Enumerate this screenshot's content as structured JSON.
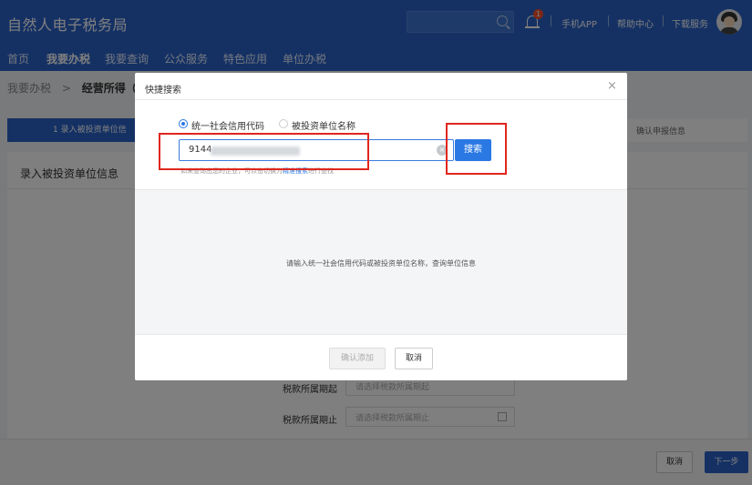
{
  "header": {
    "brand": "自然人电子税务局",
    "notification_count": "1",
    "links": [
      "手机APP",
      "帮助中心",
      "下载服务"
    ]
  },
  "nav": {
    "items": [
      "首页",
      "我要办税",
      "我要查询",
      "公众服务",
      "特色应用",
      "单位办税"
    ],
    "active": "我要办税"
  },
  "breadcrumb": {
    "parent": "我要办税",
    "separator": ">",
    "current": "经营所得（A表"
  },
  "steps": {
    "first": "1  录入被投资单位信",
    "last": "确认申报信息"
  },
  "panel": {
    "title": "录入被投资单位信息",
    "fields": [
      {
        "label": "税款所属期起",
        "placeholder": "请选择税款所属期起"
      },
      {
        "label": "税款所属期止",
        "placeholder": "请选择税款所属期止"
      }
    ]
  },
  "footer": {
    "cancel": "取消",
    "next": "下一步"
  },
  "modal": {
    "title": "快捷搜索",
    "close": "×",
    "radio_options": [
      {
        "label": "统一社会信用代码",
        "checked": true
      },
      {
        "label": "被投资单位名称",
        "checked": false
      }
    ],
    "input_value": "9144",
    "clear": "×",
    "search_button": "搜索",
    "hint_prefix": "如未查询出您的企业，可点击切换为",
    "hint_link": "精准搜索",
    "hint_suffix": "进行查找",
    "empty_message": "请输入统一社会信用代码或被投资单位名称，查询单位信息",
    "confirm_button": "确认添加",
    "cancel_button": "取消"
  },
  "colors": {
    "brand_blue": "#2a63c9",
    "accent_blue": "#2a78e4",
    "highlight_red": "#e0261e"
  }
}
